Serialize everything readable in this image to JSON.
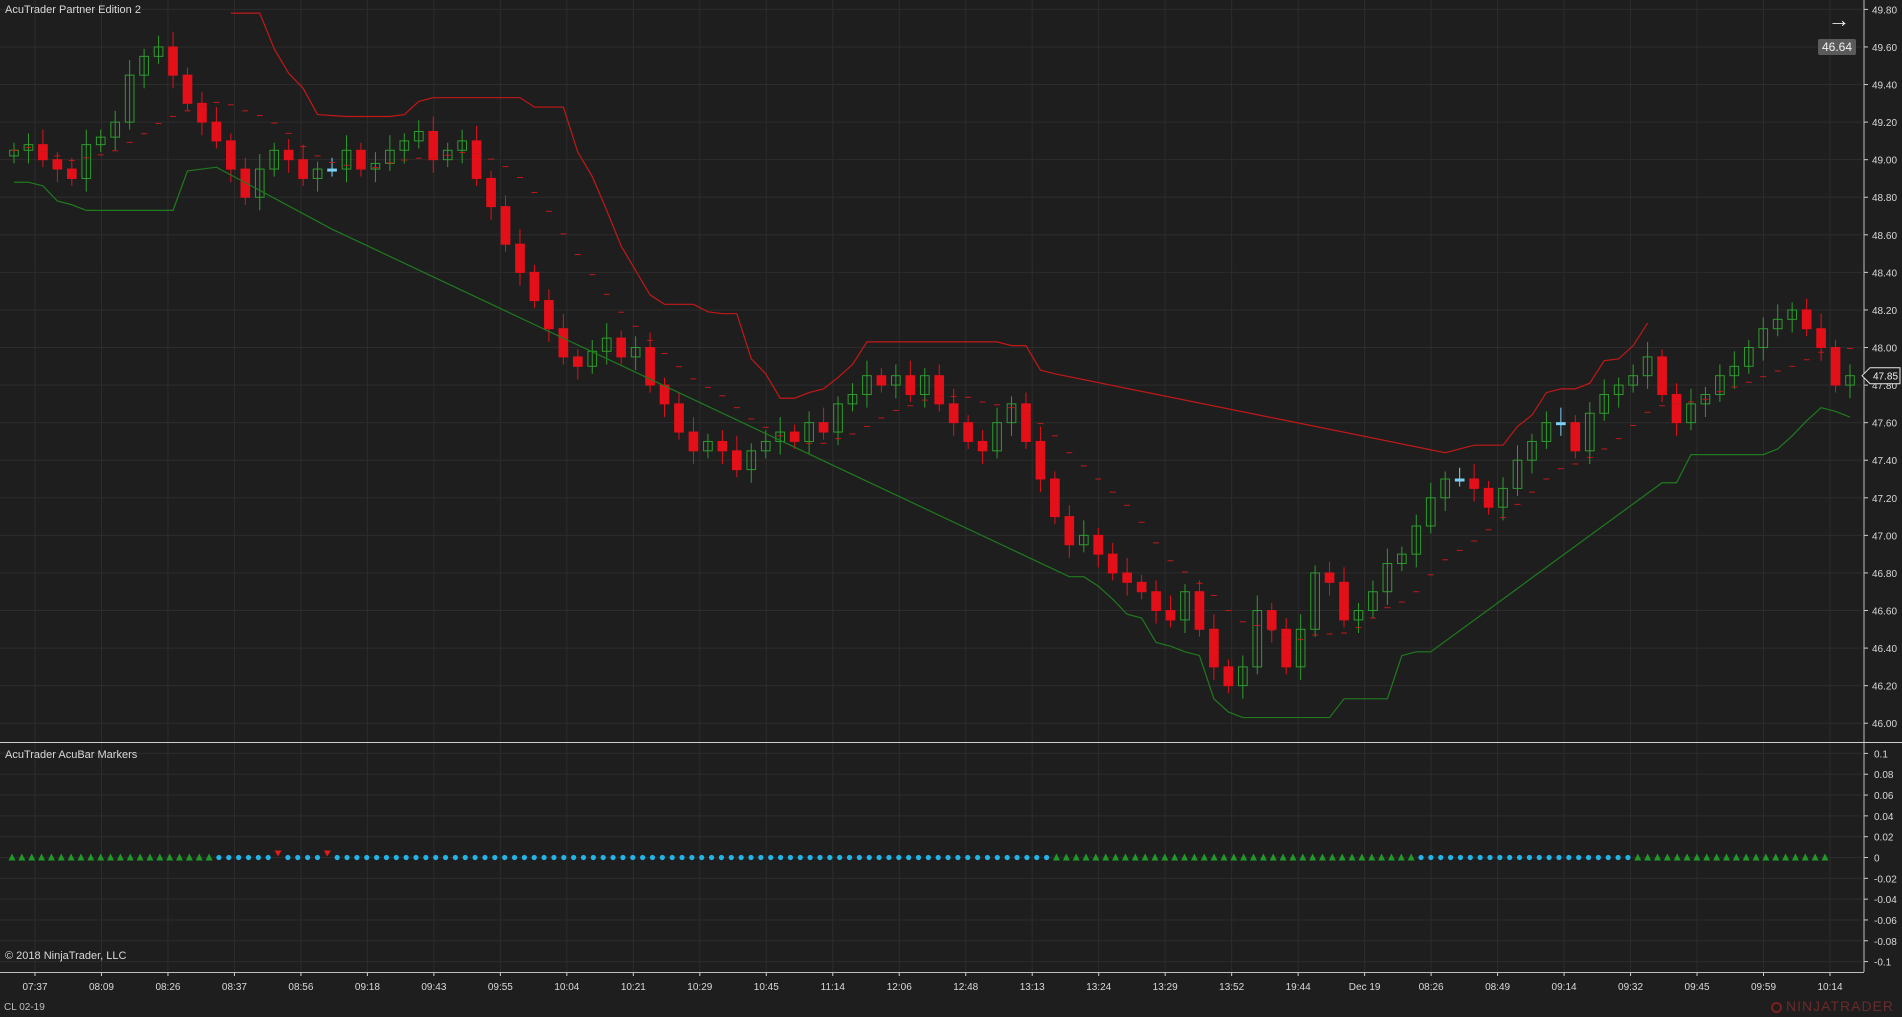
{
  "window": {
    "title": "AcuTrader Partner Edition 2",
    "indicator_title": "AcuTrader AcuBar Markers",
    "copyright": "© 2018 NinjaTrader, LLC",
    "instrument": "CL 02-19",
    "brand": "NINJATRADER",
    "countdown": "46.64",
    "arrow_icon": "right-arrow-icon"
  },
  "colors": {
    "background": "#1e1e1e",
    "grid": "#2c2c2c",
    "up_candle": "#2e9b2e",
    "down_candle": "#e3101a",
    "neutral_candle": "#7ad0f5",
    "red_line": "#c21818",
    "green_line": "#1f7a1f",
    "marker_up": "#1f9a2a",
    "marker_down": "#e11a1a",
    "marker_dot": "#22b4e8"
  },
  "chart_data": [
    {
      "type": "candlestick",
      "name": "price",
      "ylim": [
        45.9,
        49.85
      ],
      "y_ticks": [
        46.0,
        46.2,
        46.4,
        46.6,
        46.8,
        47.0,
        47.2,
        47.4,
        47.6,
        47.8,
        48.0,
        48.2,
        48.4,
        48.6,
        48.8,
        49.0,
        49.2,
        49.4,
        49.6,
        49.8
      ],
      "y_tick_labels": [
        "46.00",
        "46.20",
        "46.40",
        "46.60",
        "46.80",
        "47.00",
        "47.20",
        "47.40",
        "47.60",
        "47.80",
        "48.00",
        "48.20",
        "48.40",
        "48.60",
        "48.80",
        "49.00",
        "49.20",
        "49.40",
        "49.60",
        "49.80"
      ],
      "last_price": 47.85,
      "last_price_label": "47.85",
      "x_tick_labels": [
        "07:37",
        "08:09",
        "08:26",
        "08:37",
        "08:56",
        "09:18",
        "09:43",
        "09:55",
        "10:04",
        "10:21",
        "10:29",
        "10:45",
        "11:14",
        "12:06",
        "12:48",
        "13:13",
        "13:24",
        "13:29",
        "13:52",
        "19:44",
        "Dec 19",
        "08:26",
        "08:49",
        "09:14",
        "09:32",
        "09:45",
        "09:59",
        "10:14"
      ],
      "grid": true,
      "closes": [
        49.05,
        49.08,
        49.0,
        48.95,
        48.9,
        49.08,
        49.12,
        49.2,
        49.45,
        49.55,
        49.6,
        49.45,
        49.3,
        49.2,
        49.1,
        48.95,
        48.8,
        48.95,
        49.05,
        49.0,
        48.9,
        48.95,
        48.95,
        49.05,
        48.95,
        48.98,
        49.05,
        49.1,
        49.15,
        49.0,
        49.05,
        49.1,
        48.9,
        48.75,
        48.55,
        48.4,
        48.25,
        48.1,
        47.95,
        47.9,
        47.98,
        48.05,
        47.95,
        48.0,
        47.8,
        47.7,
        47.55,
        47.45,
        47.5,
        47.45,
        47.35,
        47.45,
        47.5,
        47.55,
        47.5,
        47.6,
        47.55,
        47.7,
        47.75,
        47.85,
        47.8,
        47.85,
        47.75,
        47.85,
        47.7,
        47.6,
        47.5,
        47.45,
        47.6,
        47.7,
        47.5,
        47.3,
        47.1,
        46.95,
        47.0,
        46.9,
        46.8,
        46.75,
        46.7,
        46.6,
        46.55,
        46.7,
        46.5,
        46.3,
        46.2,
        46.3,
        46.6,
        46.5,
        46.3,
        46.5,
        46.8,
        46.75,
        46.55,
        46.6,
        46.7,
        46.85,
        46.9,
        47.05,
        47.2,
        47.3,
        47.3,
        47.25,
        47.15,
        47.25,
        47.4,
        47.5,
        47.6,
        47.6,
        47.45,
        47.65,
        47.75,
        47.8,
        47.85,
        47.95,
        47.75,
        47.6,
        47.7,
        47.75,
        47.85,
        47.9,
        48.0,
        48.1,
        48.15,
        48.2,
        48.1,
        48.0,
        47.8,
        47.85
      ]
    },
    {
      "type": "line",
      "name": "indicator-markers",
      "ylim": [
        -0.11,
        0.11
      ],
      "y_ticks": [
        0.1,
        0.08,
        0.06,
        0.04,
        0.02,
        0,
        -0.02,
        -0.04,
        -0.06,
        -0.08,
        -0.1
      ],
      "y_tick_labels": [
        "0.1",
        "0.08",
        "0.06",
        "0.04",
        "0.02",
        "0",
        "-0.02",
        "-0.04",
        "-0.06",
        "-0.08",
        "-0.1"
      ],
      "marker_pattern": "uuuuuuuuuuuuuuuuuuuuunnnnnndnnnndnnnnnnnnnnnnnnnnnnnnnnnnnnnnnnnnnnnnnnnnnnnnnnnnnnnnnnnnnnnnnnnnnnnnnnnnnuuuuuuuuuuuuuuuuuuuuuuuuuuuuuuuuuuuuunnnnnnnnnnnnnnnnnnnnnnuuuuuuuuuuuuuuuuuuuu"
    }
  ]
}
